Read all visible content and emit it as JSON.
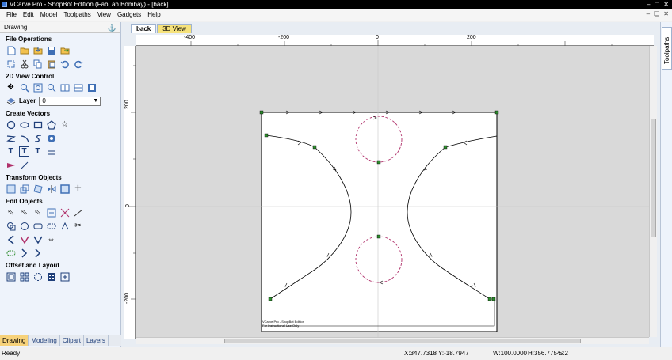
{
  "window": {
    "title": "VCarve Pro - ShopBot Edition (FabLab Bombay) - [back]"
  },
  "menu": [
    "File",
    "Edit",
    "Model",
    "Toolpaths",
    "View",
    "Gadgets",
    "Help"
  ],
  "left_panel": {
    "header": "Drawing",
    "pin_icon": "pin-icon",
    "sections": {
      "file_operations": "File Operations",
      "view_control": "2D View Control",
      "layer_label": "Layer",
      "layer_value": "0",
      "create_vectors": "Create Vectors",
      "transform_objects": "Transform Objects",
      "edit_objects": "Edit Objects",
      "offset_layout": "Offset and Layout"
    },
    "bottom_tabs": [
      "Drawing",
      "Modeling",
      "Clipart",
      "Layers"
    ]
  },
  "document": {
    "tabs": [
      "back",
      "3D View"
    ],
    "ruler_top_labels": [
      "-400",
      "-200",
      "0",
      "200"
    ],
    "ruler_left_labels": [
      "200",
      "0",
      "-200"
    ],
    "corner_text_line1": "VCarve Pro - ShopBot Edition",
    "corner_text_line2": "For Instructional Use Only"
  },
  "right_panel": {
    "tab": "Toolpaths"
  },
  "status": {
    "ready": "Ready",
    "coords": "X:347.7318 Y:-18.7947",
    "width": "W:100.0000",
    "height": "H:356.7754",
    "selected": "S:2"
  },
  "colors": {
    "accent_tab": "#f7d27a",
    "selection_dashed": "#b0306a",
    "node_green": "#2e8b2e",
    "panel_bg": "#eef3fb"
  }
}
